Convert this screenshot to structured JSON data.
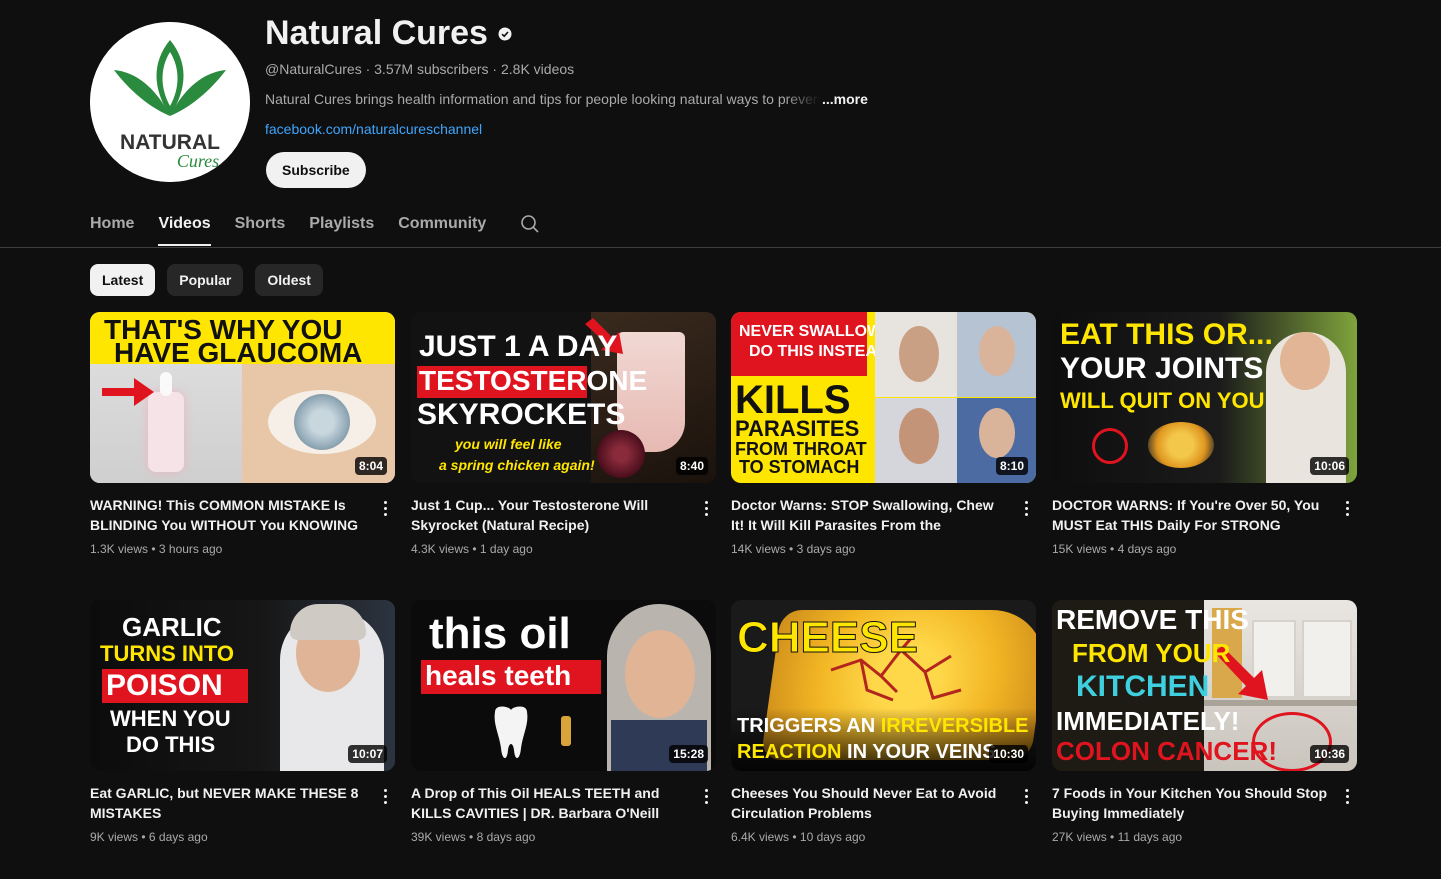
{
  "channel": {
    "name": "Natural Cures",
    "handle": "@NaturalCures",
    "subscribers": "3.57M subscribers",
    "videos_count": "2.8K videos",
    "separator": " · ",
    "description": "Natural Cures brings health information and tips for people looking natural ways to prevent",
    "more_label": "...more",
    "link": "facebook.com/naturalcureschannel",
    "subscribe_label": "Subscribe",
    "logo_text_main": "NATURAL",
    "logo_text_script": "Cures",
    "brand_green": "#2a8a3e"
  },
  "tabs": [
    "Home",
    "Videos",
    "Shorts",
    "Playlists",
    "Community"
  ],
  "active_tab": "Videos",
  "chips": [
    "Latest",
    "Popular",
    "Oldest"
  ],
  "active_chip": "Latest",
  "videos": [
    {
      "title": "WARNING! This COMMON MISTAKE Is BLINDING You WITHOUT You KNOWING",
      "views": "1.3K views",
      "age": "3 hours ago",
      "duration": "8:04",
      "thumb_lines": [
        "THAT'S WHY YOU",
        "HAVE GLAUCOMA"
      ]
    },
    {
      "title": "Just 1 Cup... Your Testosterone Will Skyrocket (Natural Recipe)",
      "views": "4.3K views",
      "age": "1 day ago",
      "duration": "8:40",
      "thumb_lines": [
        "JUST 1 A DAY",
        "TESTOSTERONE",
        "SKYROCKETS",
        "you will feel like",
        "a spring chicken again!"
      ]
    },
    {
      "title": "Doctor Warns: STOP Swallowing, Chew It! It Will Kill Parasites From the Esophagus to t...",
      "views": "14K views",
      "age": "3 days ago",
      "duration": "8:10",
      "thumb_lines": [
        "NEVER SWALLOW IT,",
        "DO THIS INSTEAD!",
        "KILLS",
        "PARASITES",
        "FROM THROAT",
        "TO STOMACH"
      ]
    },
    {
      "title": "DOCTOR WARNS: If You're Over 50, You MUST Eat THIS Daily For STRONG KNEES",
      "views": "15K views",
      "age": "4 days ago",
      "duration": "10:06",
      "thumb_lines": [
        "EAT THIS OR...",
        "YOUR JOINTS",
        "WILL QUIT ON YOU"
      ]
    },
    {
      "title": "Eat GARLIC, but NEVER MAKE THESE 8 MISTAKES",
      "views": "9K views",
      "age": "6 days ago",
      "duration": "10:07",
      "thumb_lines": [
        "GARLIC",
        "TURNS INTO",
        "POISON",
        "WHEN YOU",
        "DO THIS"
      ]
    },
    {
      "title": "A Drop of This Oil HEALS TEETH and KILLS CAVITIES | DR. Barbara O'Neill Natural...",
      "views": "39K views",
      "age": "8 days ago",
      "duration": "15:28",
      "thumb_lines": [
        "this oil",
        "heals teeth"
      ]
    },
    {
      "title": "Cheeses You Should Never Eat to Avoid Circulation Problems",
      "views": "6.4K views",
      "age": "10 days ago",
      "duration": "10:30",
      "thumb_lines": [
        "CHEESE",
        "TRIGGERS AN ",
        "IRREVERSIBLE",
        "REACTION",
        " IN YOUR VEINS"
      ]
    },
    {
      "title": "7 Foods in Your Kitchen You Should Stop Buying Immediately",
      "views": "27K views",
      "age": "11 days ago",
      "duration": "10:36",
      "thumb_lines": [
        "REMOVE THIS",
        "FROM YOUR",
        "KITCHEN",
        "IMMEDIATELY!",
        "COLON CANCER!"
      ]
    }
  ],
  "colors": {
    "background": "#0f0f0f",
    "text_primary": "#f1f1f1",
    "text_secondary": "#aaaaaa",
    "link": "#3ea6ff",
    "chip": "#272727",
    "thumb_yellow": "#ffe600",
    "thumb_red": "#e0141e"
  }
}
